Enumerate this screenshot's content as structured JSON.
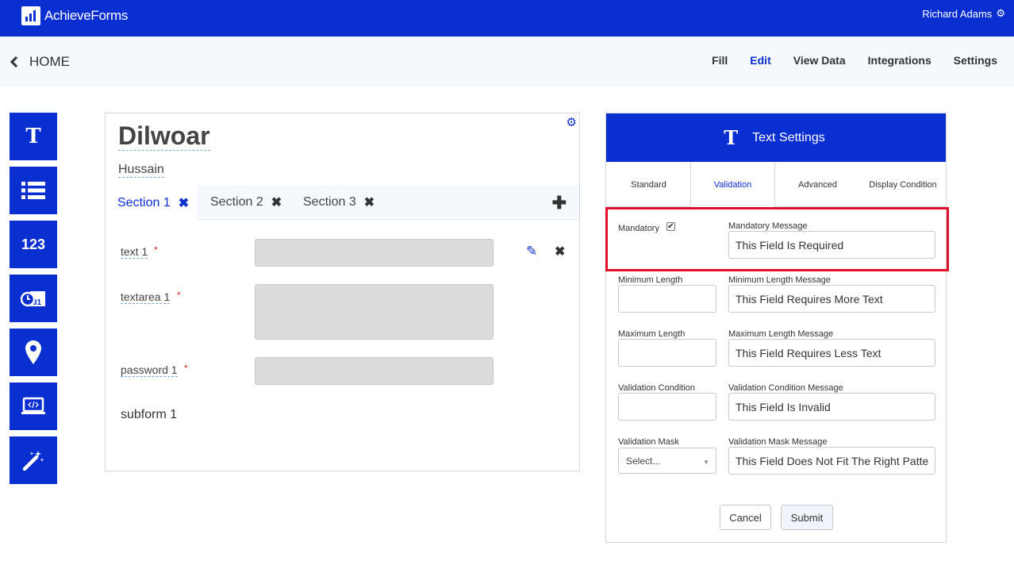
{
  "header": {
    "brand": "AchieveForms",
    "user": "Richard Adams"
  },
  "subnav": {
    "home_label": "HOME",
    "links": [
      "Fill",
      "Edit",
      "View Data",
      "Integrations",
      "Settings"
    ],
    "active": "Edit"
  },
  "toolbar": {
    "items": [
      {
        "name": "text-tool",
        "icon": "text-T-icon",
        "label": "T"
      },
      {
        "name": "list-tool",
        "icon": "list-icon"
      },
      {
        "name": "number-tool",
        "icon": "number-icon",
        "label": "123"
      },
      {
        "name": "datetime-tool",
        "icon": "calendar-clock-icon"
      },
      {
        "name": "location-tool",
        "icon": "map-pin-icon"
      },
      {
        "name": "html-tool",
        "icon": "laptop-code-icon"
      },
      {
        "name": "wizard-tool",
        "icon": "magic-wand-icon"
      }
    ]
  },
  "form": {
    "title": "Dilwoar",
    "subtitle": "Hussain",
    "tabs": [
      {
        "label": "Section 1",
        "active": true
      },
      {
        "label": "Section 2",
        "active": false
      },
      {
        "label": "Section 3",
        "active": false
      }
    ],
    "fields": [
      {
        "label": "text 1",
        "required_mark": "*"
      },
      {
        "label": "textarea 1",
        "required_mark": "*"
      },
      {
        "label": "password 1",
        "required_mark": "*"
      }
    ],
    "subform_label": "subform 1"
  },
  "panel": {
    "icon_label": "T",
    "title": "Text Settings",
    "tabs": [
      "Standard",
      "Validation",
      "Advanced",
      "Display Condition"
    ],
    "active_tab": "Validation",
    "mandatory": {
      "label": "Mandatory",
      "checked": true,
      "message_label": "Mandatory Message",
      "message_value": "This Field Is Required"
    },
    "min_length": {
      "label": "Minimum Length",
      "value": "",
      "message_label": "Minimum Length Message",
      "message_value": "This Field Requires More Text"
    },
    "max_length": {
      "label": "Maximum Length",
      "value": "",
      "message_label": "Maximum Length Message",
      "message_value": "This Field Requires Less Text"
    },
    "validation_condition": {
      "label": "Validation Condition",
      "value": "",
      "message_label": "Validation Condition Message",
      "message_value": "This Field Is Invalid"
    },
    "validation_mask": {
      "label": "Validation Mask",
      "selected": "Select...",
      "message_label": "Validation Mask Message",
      "message_value": "This Field Does Not Fit The Right Patte"
    },
    "cancel_label": "Cancel",
    "submit_label": "Submit"
  },
  "colors": {
    "brand_blue": "#0a2fd1",
    "highlight_red": "#e0102c"
  }
}
